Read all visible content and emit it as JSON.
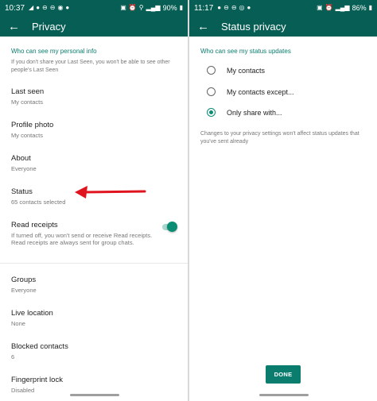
{
  "left": {
    "statusbar": {
      "time": "10:37",
      "battery": "90%"
    },
    "title": "Privacy",
    "section_header": "Who can see my personal info",
    "section_sub": "If you don't share your Last Seen, you won't be able to see other people's Last Seen",
    "items": [
      {
        "label": "Last seen",
        "value": "My contacts"
      },
      {
        "label": "Profile photo",
        "value": "My contacts"
      },
      {
        "label": "About",
        "value": "Everyone"
      },
      {
        "label": "Status",
        "value": "65 contacts selected"
      },
      {
        "label": "Read receipts",
        "value": "If turned off, you won't send or receive Read receipts. Read receipts are always sent for group chats.",
        "toggle_on": true
      },
      {
        "label": "Groups",
        "value": "Everyone"
      },
      {
        "label": "Live location",
        "value": "None"
      },
      {
        "label": "Blocked contacts",
        "value": "6"
      },
      {
        "label": "Fingerprint lock",
        "value": "Disabled"
      }
    ]
  },
  "right": {
    "statusbar": {
      "time": "11:17",
      "battery": "86%"
    },
    "title": "Status privacy",
    "section_header": "Who can see my status updates",
    "options": [
      {
        "label": "My contacts",
        "selected": false
      },
      {
        "label": "My contacts except...",
        "selected": false
      },
      {
        "label": "Only share with...",
        "selected": true
      }
    ],
    "note": "Changes to your privacy settings won't affect status updates that you've sent already",
    "done_label": "DONE"
  },
  "colors": {
    "header": "#075e54",
    "accent": "#0a8d73",
    "arrow": "#e0141e"
  },
  "icons": [
    "back-arrow-icon",
    "toggle-switch",
    "radio-button",
    "annotation-arrow"
  ]
}
